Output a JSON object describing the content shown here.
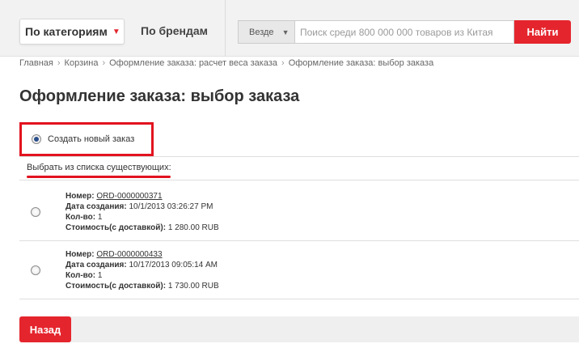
{
  "header": {
    "categories_label": "По категориям",
    "categories_arrow": "▼",
    "brands_label": "По брендам",
    "search_scope": "Везде",
    "search_scope_caret": "▼",
    "search_placeholder": "Поиск среди 800 000 000 товаров из Китая",
    "search_button": "Найти"
  },
  "breadcrumb": {
    "items": [
      "Главная",
      "Корзина",
      "Оформление заказа: расчет веса заказа",
      "Оформление заказа: выбор заказа"
    ],
    "separator": "›"
  },
  "page_title": "Оформление заказа: выбор заказа",
  "new_order": {
    "label": "Создать новый заказ",
    "selected": true
  },
  "choose_existing_label": "Выбрать из списка существующих:",
  "orders": [
    {
      "number_label": "Номер:",
      "number": "ORD-0000000371",
      "date_label": "Дата создания:",
      "date": "10/1/2013 03:26:27 PM",
      "qty_label": "Кол-во:",
      "qty": "1",
      "cost_label": "Стоимость(с доставкой):",
      "cost": "1 280.00 RUB"
    },
    {
      "number_label": "Номер:",
      "number": "ORD-0000000433",
      "date_label": "Дата создания:",
      "date": "10/17/2013 09:05:14 AM",
      "qty_label": "Кол-во:",
      "qty": "1",
      "cost_label": "Стоимость(с доставкой):",
      "cost": "1 730.00 RUB"
    }
  ],
  "back_button": "Назад",
  "colors": {
    "accent": "#e5252d",
    "highlight": "#e2131f",
    "header_bg": "#f2f2f2"
  }
}
